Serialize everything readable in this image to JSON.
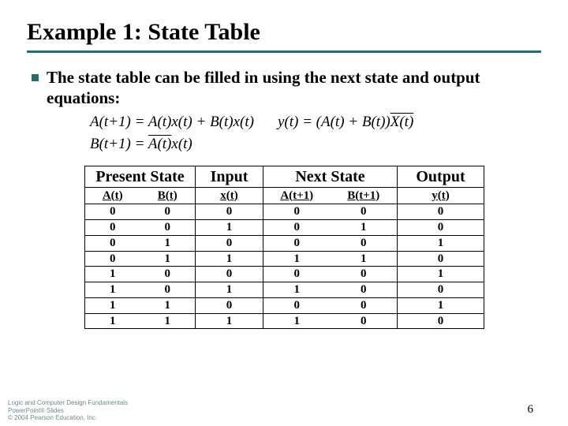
{
  "title": "Example 1: State Table",
  "bullet": "The state table can be filled in using the next state and output equations:",
  "equations": {
    "a_next": "A(t+1) = A(t)x(t) + B(t)x(t)",
    "y_out_prefix": "y(t) = (A(t) + B(t))",
    "y_out_bar": "X(t)",
    "b_next_prefix": "B(t+1) = ",
    "b_next_bar": "A(t)",
    "b_next_suffix": "x(t)"
  },
  "table": {
    "group_headers": [
      "Present State",
      "Input",
      "Next State",
      "Output"
    ],
    "sub_headers": [
      "A(t)",
      "B(t)",
      "x(t)",
      "A(t+1)",
      "B(t+1)",
      "y(t)"
    ],
    "rows": [
      [
        "0",
        "0",
        "0",
        "0",
        "0",
        "0"
      ],
      [
        "0",
        "0",
        "1",
        "0",
        "1",
        "0"
      ],
      [
        "0",
        "1",
        "0",
        "0",
        "0",
        "1"
      ],
      [
        "0",
        "1",
        "1",
        "1",
        "1",
        "0"
      ],
      [
        "1",
        "0",
        "0",
        "0",
        "0",
        "1"
      ],
      [
        "1",
        "0",
        "1",
        "1",
        "0",
        "0"
      ],
      [
        "1",
        "1",
        "0",
        "0",
        "0",
        "1"
      ],
      [
        "1",
        "1",
        "1",
        "1",
        "0",
        "0"
      ]
    ]
  },
  "footer": {
    "line1": "Logic and Computer Design Fundamentals",
    "line2": "PowerPoint® Slides",
    "line3": "© 2004 Pearson Education, Inc."
  },
  "page_number": "6"
}
